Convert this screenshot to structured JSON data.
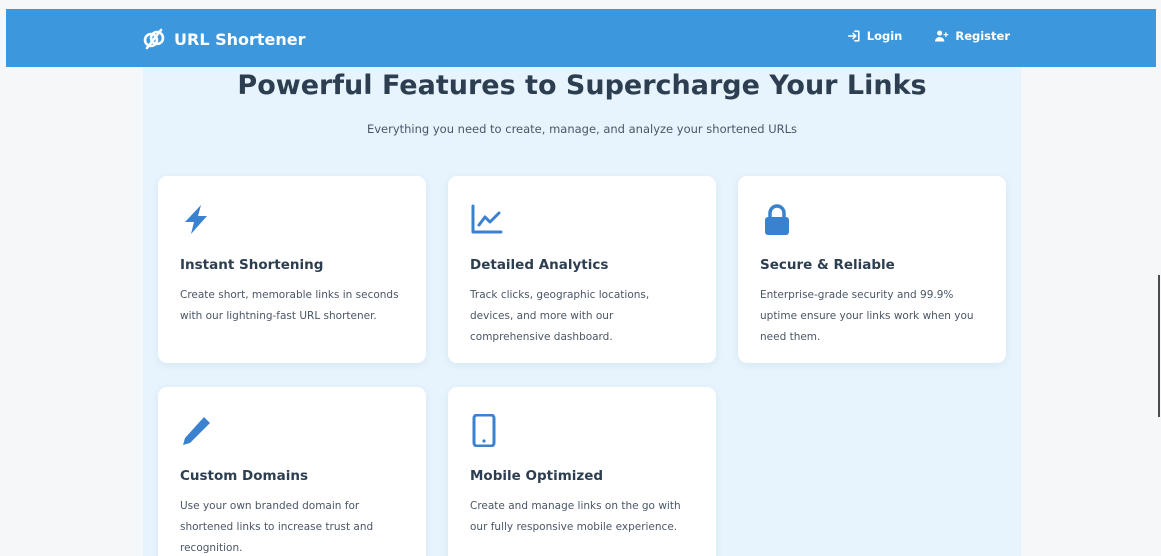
{
  "colors": {
    "navbar": "#3c97dc",
    "accent": "#3a82cf",
    "panel": "#e7f4fd",
    "card": "#ffffff"
  },
  "navbar": {
    "brand": {
      "icon": "link-icon",
      "title": "URL Shortener"
    },
    "links": [
      {
        "icon": "sign-in-icon",
        "label": "Login"
      },
      {
        "icon": "user-plus-icon",
        "label": "Register"
      }
    ]
  },
  "features": {
    "heading": "Powerful Features to Supercharge Your Links",
    "subheading": "Everything you need to create, manage, and analyze your shortened URLs",
    "cards": [
      {
        "icon": "lightning-bolt-icon",
        "title": "Instant Shortening",
        "description": "Create short, memorable links in seconds with our lightning-fast URL shortener."
      },
      {
        "icon": "line-chart-icon",
        "title": "Detailed Analytics",
        "description": "Track clicks, geographic locations, devices, and more with our comprehensive dashboard."
      },
      {
        "icon": "lock-icon",
        "title": "Secure & Reliable",
        "description": "Enterprise-grade security and 99.9% uptime ensure your links work when you need them."
      },
      {
        "icon": "pen-icon",
        "title": "Custom Domains",
        "description": "Use your own branded domain for shortened links to increase trust and recognition."
      },
      {
        "icon": "mobile-phone-icon",
        "title": "Mobile Optimized",
        "description": "Create and manage links on the go with our fully responsive mobile experience."
      }
    ]
  }
}
